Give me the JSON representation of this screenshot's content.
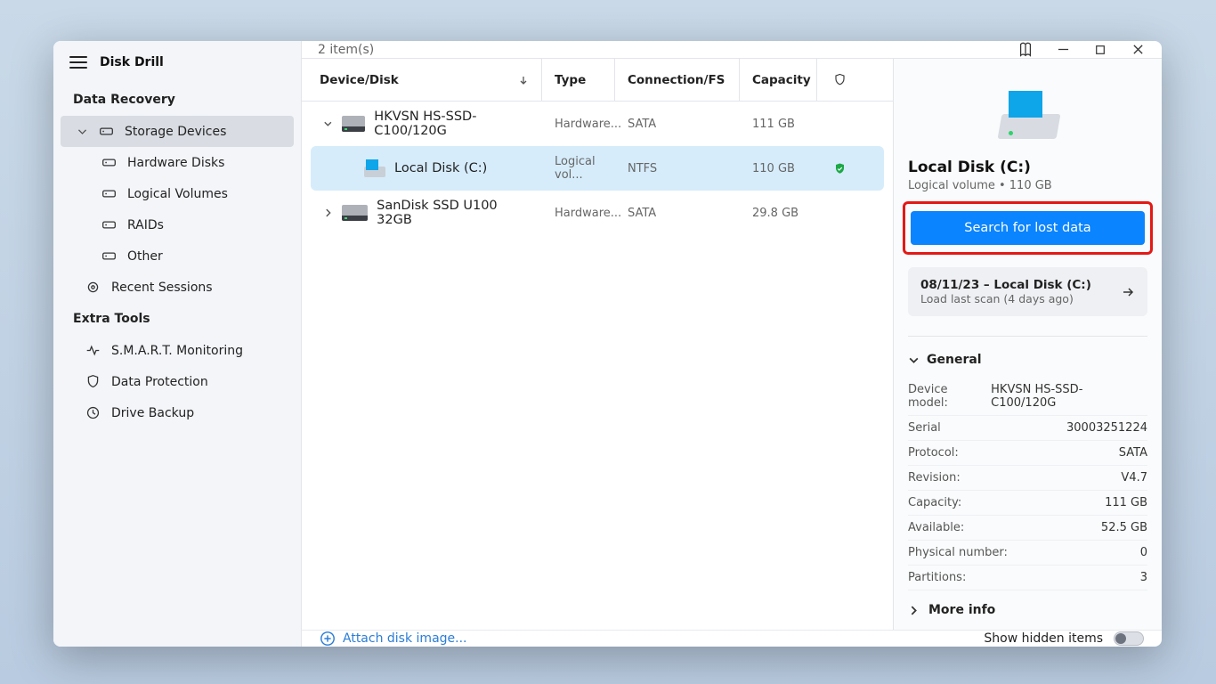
{
  "app": {
    "title": "Disk Drill",
    "item_count": "2 item(s)"
  },
  "sidebar": {
    "section_recovery": "Data Recovery",
    "storage_devices": "Storage Devices",
    "hardware_disks": "Hardware Disks",
    "logical_volumes": "Logical Volumes",
    "raids": "RAIDs",
    "other": "Other",
    "recent_sessions": "Recent Sessions",
    "section_extra": "Extra Tools",
    "smart": "S.M.A.R.T. Monitoring",
    "data_protection": "Data Protection",
    "drive_backup": "Drive Backup"
  },
  "columns": {
    "device": "Device/Disk",
    "type": "Type",
    "conn": "Connection/FS",
    "cap": "Capacity"
  },
  "rows": [
    {
      "name": "HKVSN HS-SSD-C100/120G",
      "type": "Hardware...",
      "conn": "SATA",
      "cap": "111 GB"
    },
    {
      "name": "Local Disk (C:)",
      "type": "Logical vol...",
      "conn": "NTFS",
      "cap": "110 GB"
    },
    {
      "name": "SanDisk SSD U100 32GB",
      "type": "Hardware...",
      "conn": "SATA",
      "cap": "29.8 GB"
    }
  ],
  "bottom": {
    "attach": "Attach disk image...",
    "hidden": "Show hidden items"
  },
  "details": {
    "title": "Local Disk (C:)",
    "sub": "Logical volume • 110 GB",
    "search_btn": "Search for lost data",
    "last_scan_title": "08/11/23 – Local Disk (C:)",
    "last_scan_sub": "Load last scan (4 days ago)",
    "general": "General",
    "more": "More info",
    "kv": [
      {
        "k": "Device model:",
        "v": "HKVSN HS-SSD-C100/120G"
      },
      {
        "k": "Serial",
        "v": "30003251224"
      },
      {
        "k": "Protocol:",
        "v": "SATA"
      },
      {
        "k": "Revision:",
        "v": "V4.7"
      },
      {
        "k": "Capacity:",
        "v": "111 GB"
      },
      {
        "k": "Available:",
        "v": "52.5 GB"
      },
      {
        "k": "Physical number:",
        "v": "0"
      },
      {
        "k": "Partitions:",
        "v": "3"
      }
    ]
  }
}
